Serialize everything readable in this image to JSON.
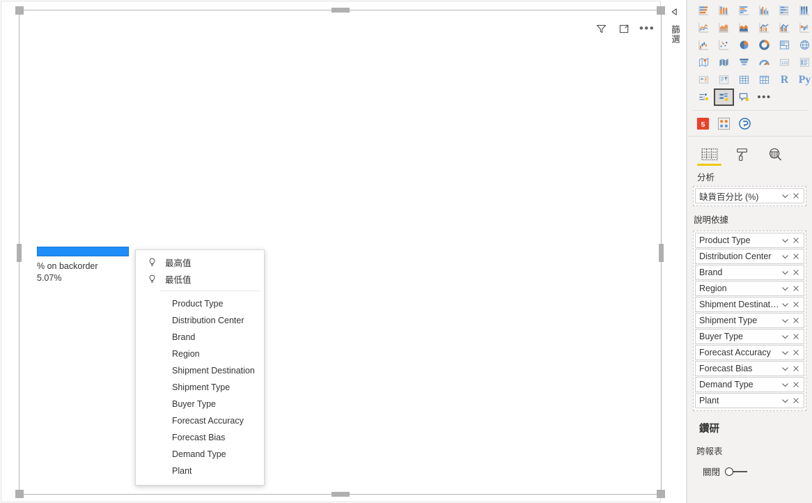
{
  "visual": {
    "actions": [
      {
        "name": "filter-icon",
        "label": "篩選"
      },
      {
        "name": "focus-mode-icon",
        "label": "焦點模式"
      },
      {
        "name": "more-options-icon",
        "label": "更多選項"
      }
    ],
    "key_influencer": {
      "bar_label": "% on backorder",
      "bar_value": "5.07%",
      "bar_percent": 5.07,
      "bar_color": "#1f8df8"
    }
  },
  "context_menu": {
    "top_items": [
      {
        "icon": "lightbulb-icon",
        "label": "最高值"
      },
      {
        "icon": "lightbulb-icon",
        "label": "最低值"
      }
    ],
    "field_items": [
      {
        "label": "Product Type"
      },
      {
        "label": "Distribution Center"
      },
      {
        "label": "Brand"
      },
      {
        "label": "Region"
      },
      {
        "label": "Shipment Destination"
      },
      {
        "label": "Shipment Type"
      },
      {
        "label": "Buyer Type"
      },
      {
        "label": "Forecast Accuracy"
      },
      {
        "label": "Forecast Bias"
      },
      {
        "label": "Demand Type"
      },
      {
        "label": "Plant"
      }
    ]
  },
  "filters_pane": {
    "title": "篩選",
    "collapse_icon": "collapse-left-icon"
  },
  "visualizations_pane": {
    "gallery": [
      {
        "name": "stacked-bar-chart-icon"
      },
      {
        "name": "stacked-column-chart-icon"
      },
      {
        "name": "clustered-bar-chart-icon"
      },
      {
        "name": "clustered-column-chart-icon"
      },
      {
        "name": "100-stacked-bar-chart-icon"
      },
      {
        "name": "100-stacked-column-chart-icon"
      },
      {
        "name": "line-chart-icon"
      },
      {
        "name": "area-chart-icon"
      },
      {
        "name": "stacked-area-chart-icon"
      },
      {
        "name": "line-and-stacked-column-chart-icon"
      },
      {
        "name": "line-and-clustered-column-chart-icon"
      },
      {
        "name": "ribbon-chart-icon"
      },
      {
        "name": "waterfall-chart-icon"
      },
      {
        "name": "scatter-chart-icon"
      },
      {
        "name": "pie-chart-icon"
      },
      {
        "name": "donut-chart-icon"
      },
      {
        "name": "treemap-icon"
      },
      {
        "name": "map-icon"
      },
      {
        "name": "filled-map-icon"
      },
      {
        "name": "shape-map-icon"
      },
      {
        "name": "funnel-chart-icon"
      },
      {
        "name": "gauge-icon"
      },
      {
        "name": "card-icon"
      },
      {
        "name": "multi-row-card-icon"
      },
      {
        "name": "kpi-icon"
      },
      {
        "name": "slicer-icon"
      },
      {
        "name": "table-icon"
      },
      {
        "name": "matrix-icon"
      },
      {
        "name": "r-script-visual-icon",
        "letter": "R"
      },
      {
        "name": "python-visual-icon",
        "letter": "Py"
      },
      {
        "name": "key-influencers-icon"
      },
      {
        "name": "decomposition-tree-icon",
        "selected": true
      },
      {
        "name": "smart-narrative-icon"
      },
      {
        "name": "more-visuals-icon",
        "dots": true
      }
    ],
    "custom_visuals": [
      {
        "name": "html-content-icon"
      },
      {
        "name": "get-more-visuals-icon"
      },
      {
        "name": "power-apps-visual-icon"
      }
    ],
    "tabs": [
      {
        "name": "fields-tab",
        "icon": "fields-table-icon",
        "active": true
      },
      {
        "name": "format-tab",
        "icon": "paint-roller-icon",
        "active": false
      },
      {
        "name": "analytics-tab",
        "icon": "magnifier-chart-icon",
        "active": false
      }
    ],
    "tab_label": "分析",
    "measure_well": {
      "fields": [
        {
          "label": "缺貨百分比 (%)"
        }
      ]
    },
    "explain_by": {
      "title": "說明依據",
      "fields": [
        {
          "label": "Product Type"
        },
        {
          "label": "Distribution Center"
        },
        {
          "label": "Brand"
        },
        {
          "label": "Region"
        },
        {
          "label": "Shipment Destination"
        },
        {
          "label": "Shipment Type"
        },
        {
          "label": "Buyer Type"
        },
        {
          "label": "Forecast Accuracy"
        },
        {
          "label": "Forecast Bias"
        },
        {
          "label": "Demand Type"
        },
        {
          "label": "Plant"
        }
      ]
    },
    "drill": {
      "title": "鑽研",
      "subtitle": "跨報表",
      "toggle_label": "關閉",
      "toggle_on": false
    }
  }
}
